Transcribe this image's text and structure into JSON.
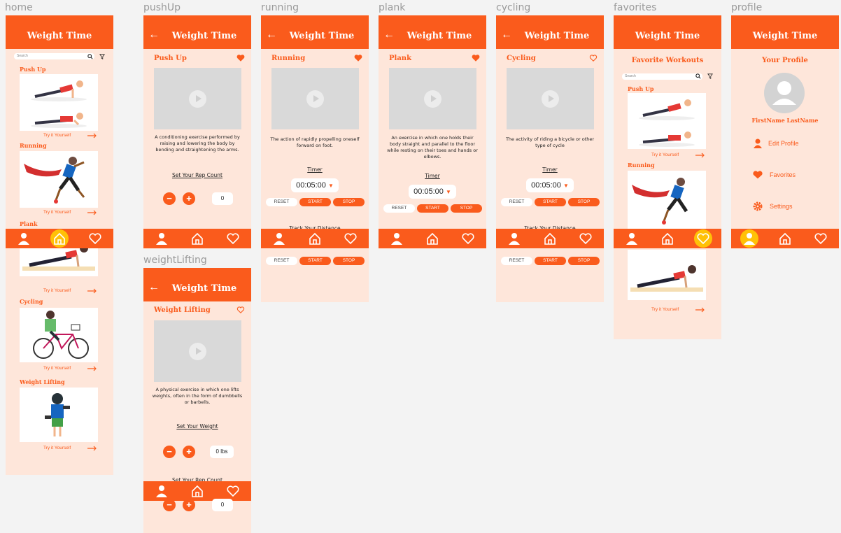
{
  "labels": {
    "home": "home",
    "pushup": "pushUp",
    "running": "running",
    "plank": "plank",
    "cycling": "cycling",
    "favorites": "favorites",
    "profile": "profile",
    "weightlifting": "weightLifting"
  },
  "app_title": "Weight Time",
  "back_arrow": "←",
  "search_placeholder": "Search",
  "try_label": "Try it Yourself",
  "workouts": {
    "pushup": "Push Up",
    "running": "Running",
    "plank": "Plank",
    "cycling": "Cycling",
    "weightlifting": "Weight Lifting"
  },
  "desc": {
    "pushup": "A conditioning exercise performed by raising and lowering the body by bending and straightening the arms.",
    "running": "The action of rapidly propelling oneself forward on foot.",
    "plank": "An exercise in which one holds their body straight and parallel to the floor while resting on their toes and hands or elbows.",
    "cycling": "The activity of riding a bicycle or other type of cycle",
    "weightlifting": "A physical exercise in which one lifts weights, often in the form of dumbbells or barbells."
  },
  "set_rep_count": "Set Your Rep Count",
  "set_weight": "Set Your Weight",
  "rep_value": "0",
  "weight_value": "0 lbs",
  "minus": "−",
  "plus": "+",
  "timer_label": "Timer",
  "timer_value": "00:05:00",
  "reset": "RESET",
  "start": "START",
  "stop": "STOP",
  "track_distance": "Track Your Distance",
  "favorites_heading": "Favorite Workouts",
  "profile": {
    "heading": "Your Profile",
    "name": "FirstName LastName",
    "edit": "Edit Profile",
    "favorites": "Favorites",
    "settings": "Settings"
  },
  "colors": {
    "accent": "#fa5b1c",
    "background": "#fee6da",
    "nav_active": "#ffc107"
  }
}
